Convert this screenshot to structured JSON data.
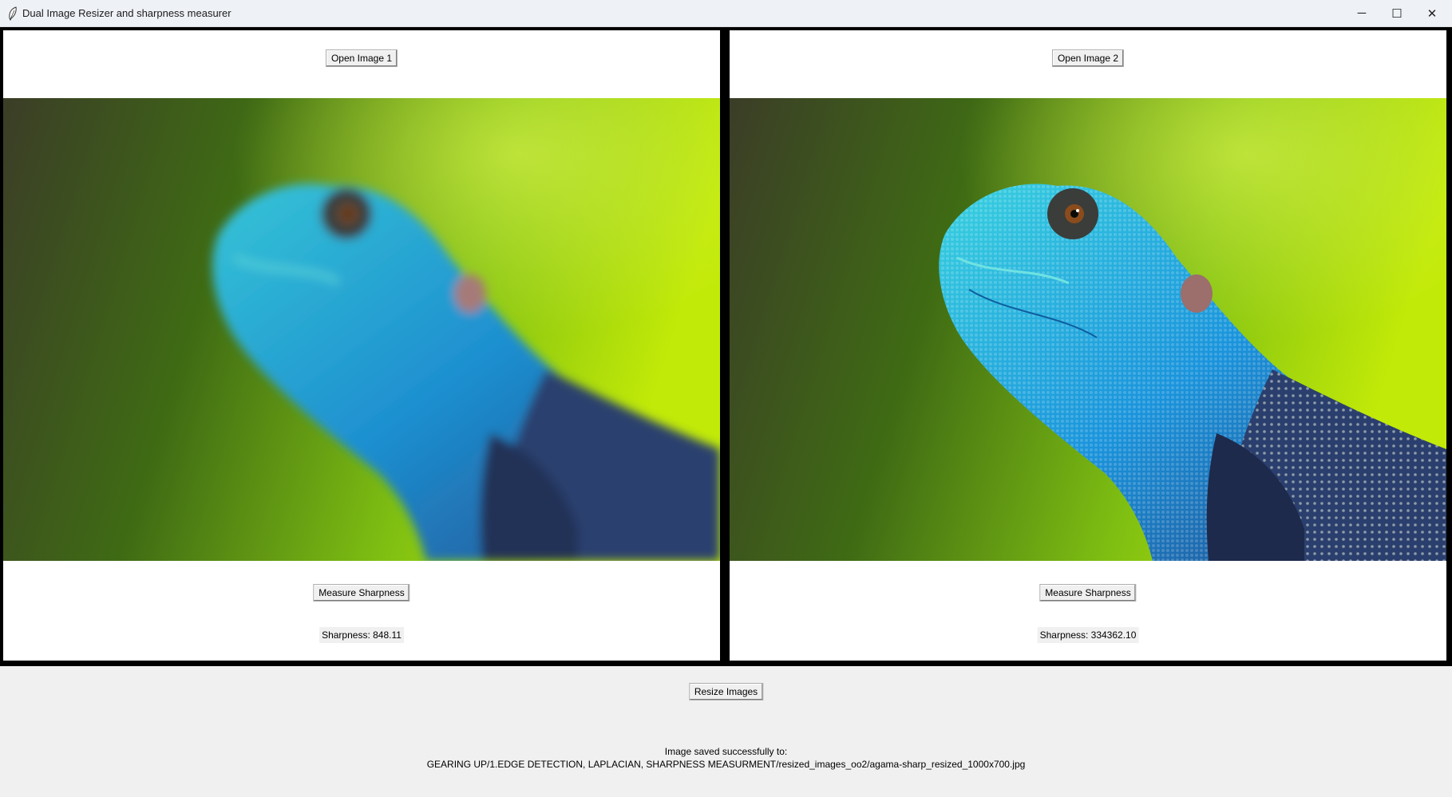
{
  "window": {
    "title": "Dual Image Resizer and sharpness measurer",
    "controls": {
      "minimize": "─",
      "maximize": "☐",
      "close": "✕"
    }
  },
  "panels": [
    {
      "open_label": "Open Image 1",
      "measure_label": "Measure Sharpness",
      "sharpness_text": "Sharpness: 848.11",
      "image_style": "blurred"
    },
    {
      "open_label": "Open Image 2",
      "measure_label": "Measure Sharpness",
      "sharpness_text": "Sharpness: 334362.10",
      "image_style": "sharp"
    }
  ],
  "resize_label": "Resize Images",
  "status": {
    "line1": "Image saved successfully to:",
    "line2": "GEARING UP/1.EDGE DETECTION, LAPLACIAN, SHARPNESS MEASURMENT/resized_images_oo2/agama-sharp_resized_1000x700.jpg"
  },
  "colors": {
    "background_green": "#8ec415",
    "background_dark": "#3a3c24",
    "lizard_blue": "#1f9fd6",
    "lizard_cyan": "#2fd0d0"
  },
  "icons": {
    "app": "feather-icon"
  }
}
